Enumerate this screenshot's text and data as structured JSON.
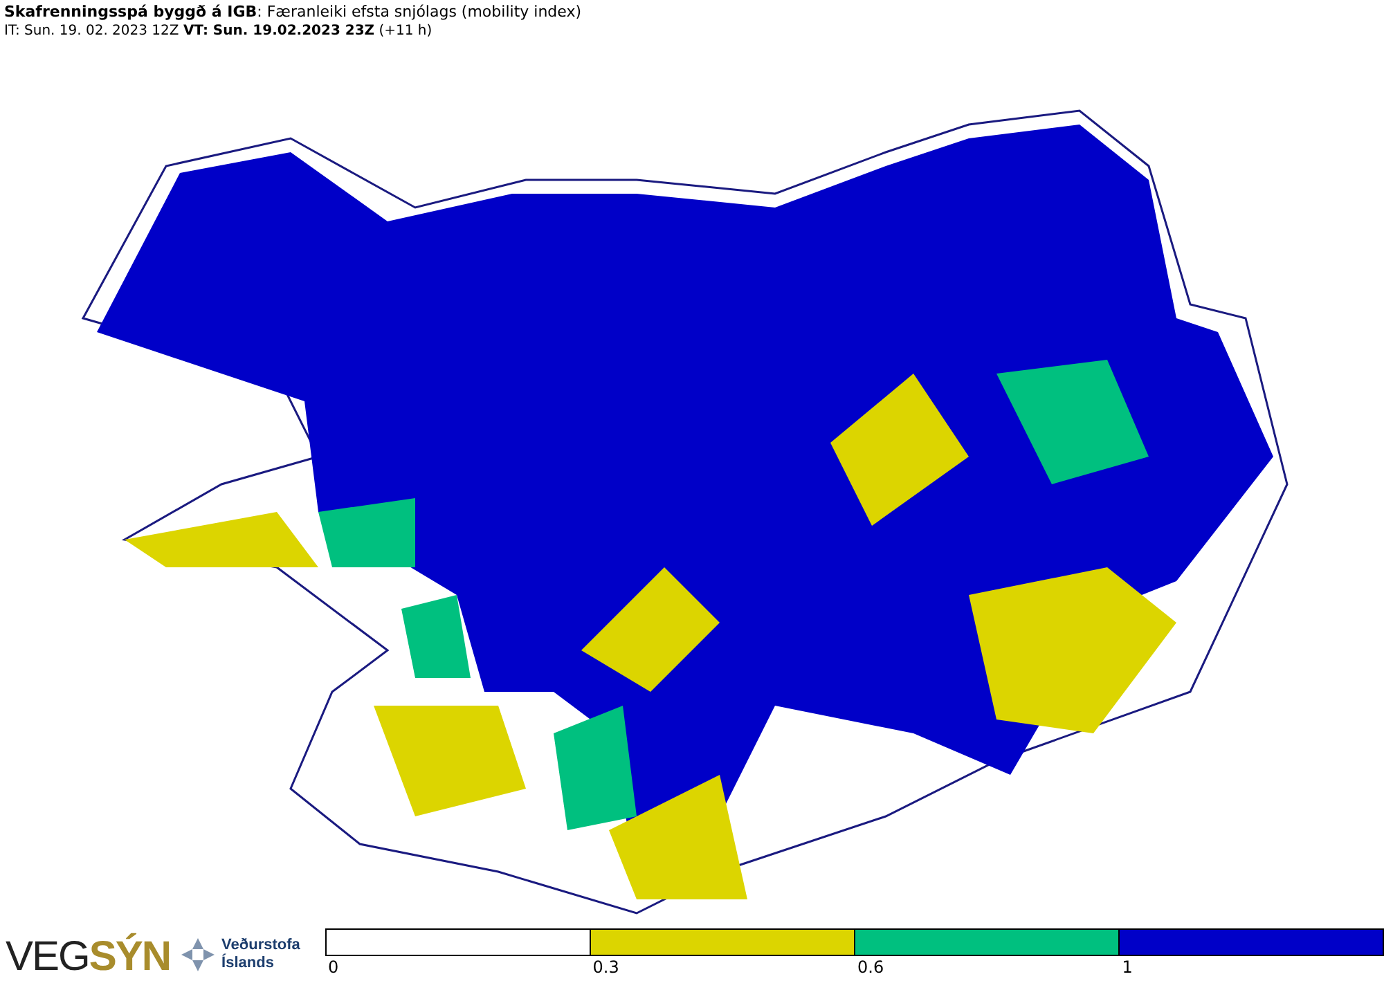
{
  "header": {
    "title": "**Skafrenningsspá byggð á IGB**: Færanleiki efsta snjólags (mobility index)",
    "subtitle": "IT: Sun. 19. 02. 2023 12Z **VT: Sun. 19.02.2023 23Z** (+11 h)"
  },
  "footer": {
    "logo_left": "VEG",
    "logo_right": "SÝN",
    "agency": "Veðurstofa Íslands"
  },
  "legend": {
    "segments": [
      {
        "color": "#ffffff"
      },
      {
        "color": "#dcd500"
      },
      {
        "color": "#00c07f"
      },
      {
        "color": "#0000c8"
      }
    ],
    "ticks": [
      "0",
      "0.3",
      "0.6",
      "1"
    ]
  }
}
